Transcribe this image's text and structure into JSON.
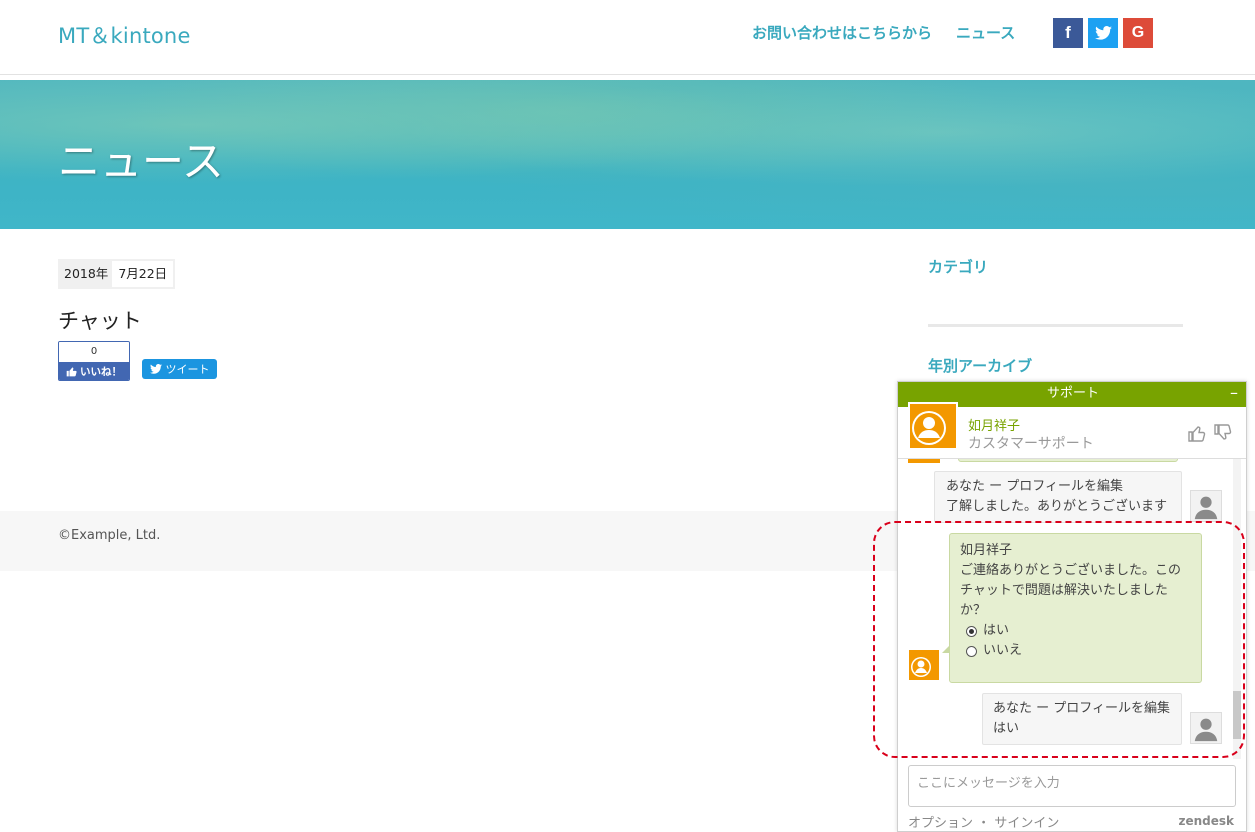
{
  "header": {
    "brand": "MT＆kintone",
    "nav": {
      "contact": "お問い合わせはこちらから",
      "news": "ニュース"
    },
    "social": {
      "facebook": "f",
      "google": "G"
    }
  },
  "hero": {
    "title": "ニュース"
  },
  "article": {
    "date_year": "2018年",
    "date_day": "7月22日",
    "title": "チャット",
    "like_count": "0",
    "like_label": "いいね！",
    "tweet_label": "ツイート"
  },
  "sidebar": {
    "category_heading": "カテゴリ",
    "archive_heading": "年別アーカイブ"
  },
  "footer": {
    "copyright": "©Example, Ltd."
  },
  "chat": {
    "title": "サポート",
    "minimize": "–",
    "agent_name": "如月祥子",
    "agent_role": "カスタマーサポート",
    "messages": [
      {
        "sender": "あなた ー プロフィールを編集",
        "text": "了解しました。ありがとうございます"
      },
      {
        "sender": "如月祥子",
        "text": "ご連絡ありがとうございました。このチャットで問題は解決いたしましたか？",
        "options": [
          "はい",
          "いいえ"
        ],
        "selected": "はい"
      },
      {
        "sender": "あなた ー プロフィールを編集",
        "text": "はい"
      }
    ],
    "input_placeholder": "ここにメッセージを入力",
    "footer_options": "オプション",
    "footer_separator": "・",
    "footer_signin": "サインイン",
    "branding": "zendesk"
  },
  "colors": {
    "accent": "#3aa9be",
    "chat_green": "#78a300",
    "agent_bubble": "#e6efd1",
    "highlight_red": "#d9001b",
    "facebook": "#3b5998",
    "twitter": "#1da1f2",
    "google": "#dd4b39"
  }
}
